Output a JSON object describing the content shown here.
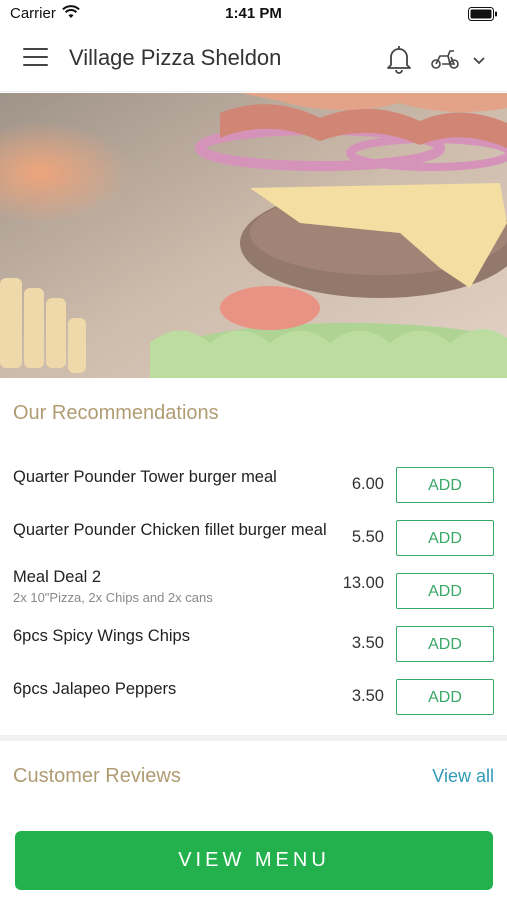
{
  "status_bar": {
    "carrier": "Carrier",
    "time": "1:41 PM",
    "icons": [
      "wifi-icon",
      "battery-icon"
    ]
  },
  "header": {
    "title": "Village Pizza Sheldon",
    "icons": [
      "menu-icon",
      "bell-icon",
      "delivery-scooter-icon",
      "chevron-down-icon"
    ]
  },
  "hero": {
    "image": "burger-photo"
  },
  "recommendations": {
    "title": "Our Recommendations",
    "items": [
      {
        "name": "Quarter Pounder Tower burger meal",
        "description": "",
        "price": "6.00",
        "button": "ADD"
      },
      {
        "name": "Quarter Pounder Chicken fillet burger meal",
        "description": "",
        "price": "5.50",
        "button": "ADD"
      },
      {
        "name": "Meal Deal 2",
        "description": "2x 10\"Pizza, 2x Chips and 2x cans",
        "price": "13.00",
        "button": "ADD"
      },
      {
        "name": "6pcs Spicy Wings Chips",
        "description": "",
        "price": "3.50",
        "button": "ADD"
      },
      {
        "name": "6pcs Jalapeo Peppers",
        "description": "",
        "price": "3.50",
        "button": "ADD"
      }
    ]
  },
  "reviews": {
    "title": "Customer Reviews",
    "view_all": "View all"
  },
  "footer": {
    "view_menu": "VIEW MENU"
  },
  "colors": {
    "accent_green": "#22b14c",
    "add_green": "#3aa867",
    "section_gold": "#b09c73",
    "link_blue": "#2e9bb8"
  }
}
